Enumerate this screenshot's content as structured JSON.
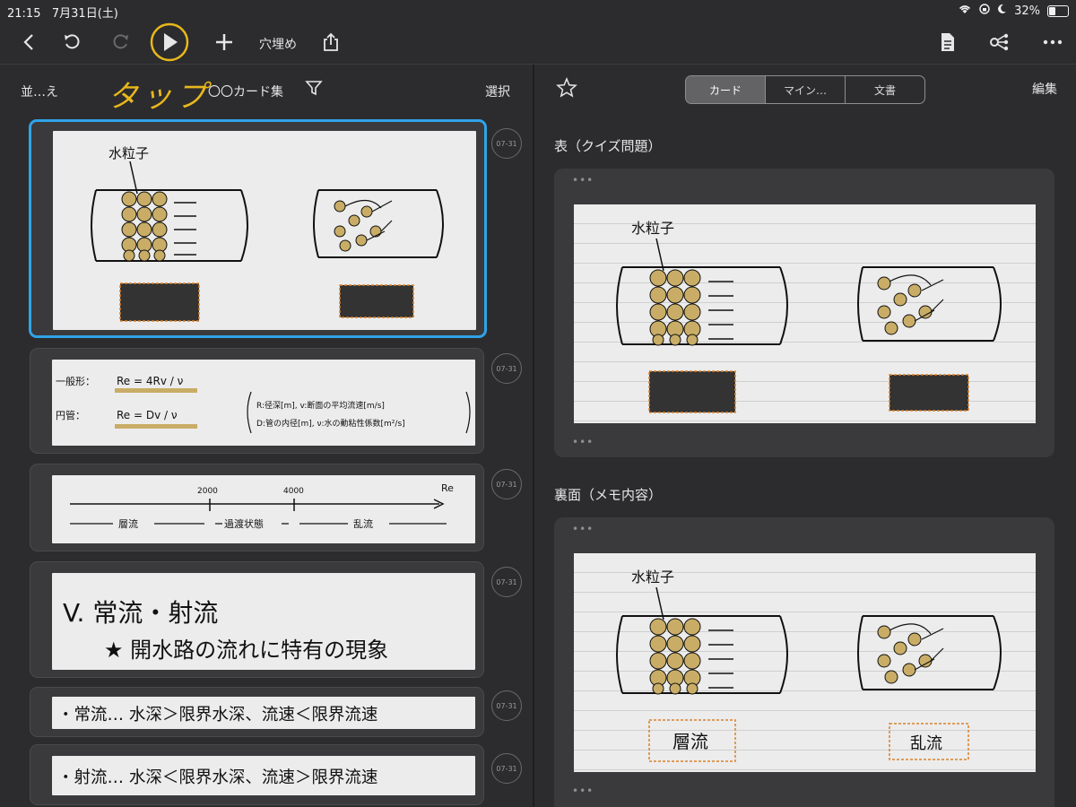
{
  "status_bar": {
    "time": "21:15",
    "date": "7月31日(土)",
    "battery": "32%"
  },
  "toolbar": {
    "title": "穴埋め"
  },
  "annotation": {
    "tap_label": "タップ"
  },
  "left_pane": {
    "sort_label": "並…え",
    "collection_name": "〇〇カード集",
    "select_label": "選択",
    "cards": [
      {
        "date": "07-31",
        "label_particle": "水粒子"
      },
      {
        "date": "07-31",
        "line1_prefix": "一般形：",
        "line1_formula": "Re = 4Rv / ν",
        "line2_prefix": "円管：",
        "line2_formula": "Re = Dv / ν",
        "note1": "R:径深[m], v:断面の平均流速[m/s]",
        "note2": "D:管の内径[m], ν:水の動粘性係数[m²/s]"
      },
      {
        "date": "07-31",
        "tick1": "2000",
        "tick2": "4000",
        "axis": "Re",
        "region1": "層流",
        "region2": "過渡状態",
        "region3": "乱流"
      },
      {
        "date": "07-31",
        "heading": "V. 常流・射流",
        "subheading": "★ 開水路の流れに特有の現象"
      },
      {
        "date": "07-31",
        "line": "・常流… 水深＞限界水深、流速＜限界流速"
      },
      {
        "date": "07-31",
        "line": "・射流… 水深＜限界水深、流速＞限界流速"
      }
    ]
  },
  "right_pane": {
    "tabs": [
      "カード",
      "マイン…",
      "文書"
    ],
    "edit_label": "編集",
    "front_title": "表（クイズ問題）",
    "back_title": "裏面（メモ内容）",
    "front_particle": "水粒子",
    "back_particle": "水粒子",
    "answer_left": "層流",
    "answer_right": "乱流",
    "more": "•••"
  },
  "colors": {
    "accent_selected": "#2fa4e7",
    "annotation": "#e8b71c",
    "blank_fill": "#333333",
    "blank_border": "#d9822b",
    "particle": "#c9ad66"
  }
}
